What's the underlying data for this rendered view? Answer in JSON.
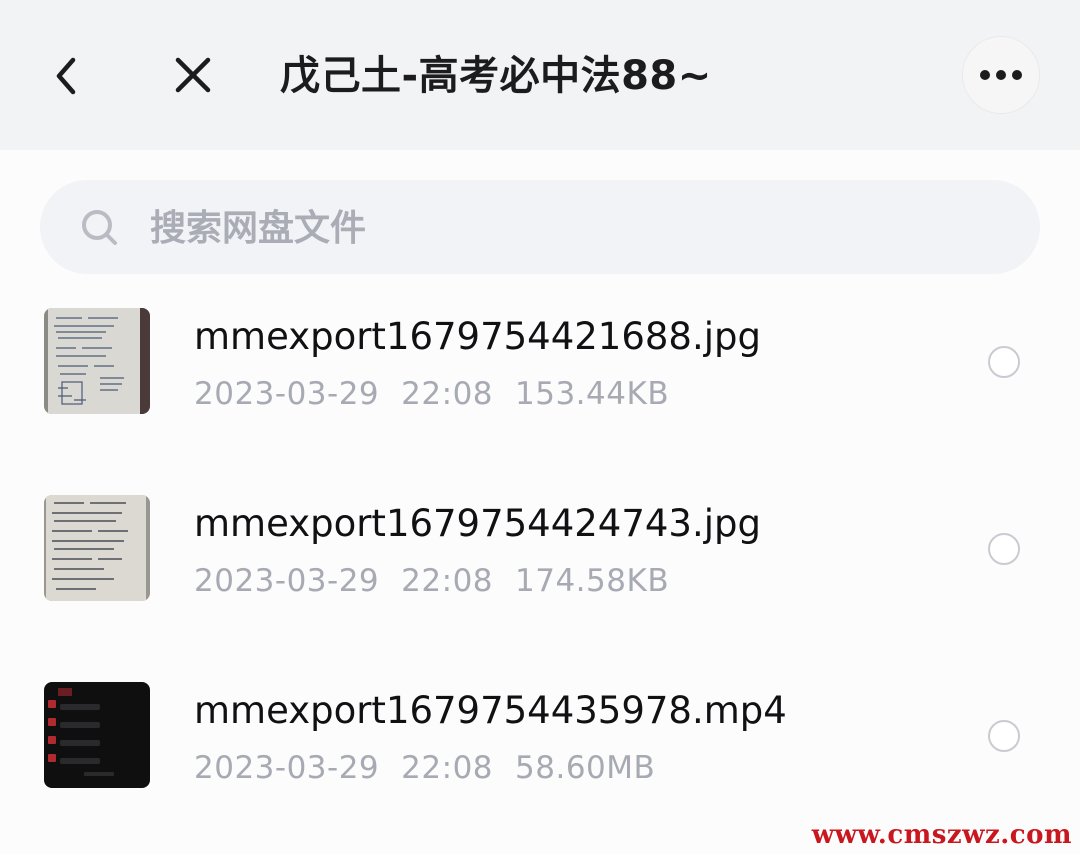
{
  "header": {
    "title": "戊己土-高考必中法88~",
    "back_icon": "chevron-left-icon",
    "close_icon": "close-icon",
    "more_icon": "more-horizontal-icon"
  },
  "search": {
    "placeholder": "搜索网盘文件",
    "value": "",
    "icon": "search-icon"
  },
  "files": [
    {
      "name": "mmexport1679754421688.jpg",
      "date": "2023-03-29",
      "time": "22:08",
      "size": "153.44KB",
      "thumb_type": "handwritten-notes-photo",
      "selected": false
    },
    {
      "name": "mmexport1679754424743.jpg",
      "date": "2023-03-29",
      "time": "22:08",
      "size": "174.58KB",
      "thumb_type": "handwritten-notes-photo",
      "selected": false
    },
    {
      "name": "mmexport1679754435978.mp4",
      "date": "2023-03-29",
      "time": "22:08",
      "size": "58.60MB",
      "thumb_type": "app-screen-video",
      "selected": false
    }
  ],
  "watermark": "www.cmszwz.com",
  "colors": {
    "header_bg": "#f2f3f5",
    "search_bg": "#f1f3f6",
    "meta_text": "#a7aab2",
    "watermark": "#c8171e"
  }
}
